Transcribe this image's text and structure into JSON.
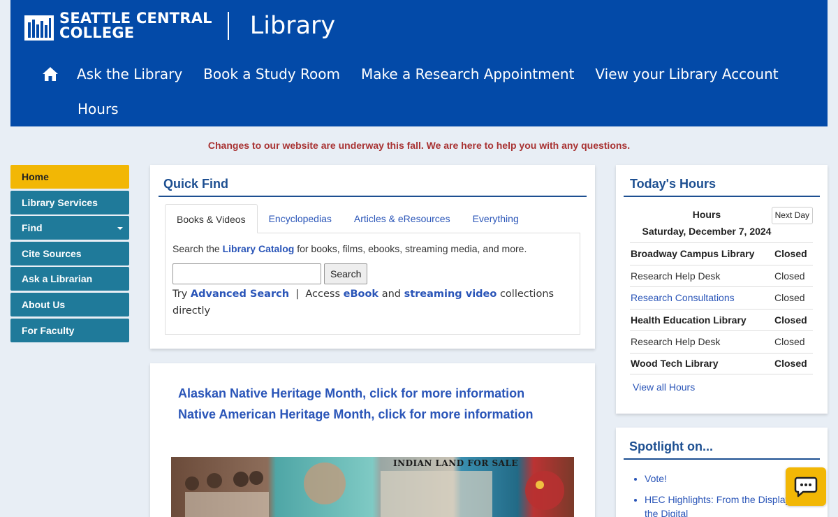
{
  "header": {
    "college_line1": "SEATTLE CENTRAL",
    "college_line2": "COLLEGE",
    "section": "Library",
    "nav": [
      "Ask the Library",
      "Book a Study Room",
      "Make a Research Appointment",
      "View your Library Account",
      "Hours"
    ]
  },
  "notice": "Changes to our website are underway this fall. We are here to help you with any questions.",
  "sidebar": {
    "items": [
      "Home",
      "Library Services",
      "Find",
      "Cite Sources",
      "Ask a Librarian",
      "About Us",
      "For Faculty"
    ],
    "active": "Home"
  },
  "quick_find": {
    "title": "Quick Find",
    "tabs": [
      "Books & Videos",
      "Encyclopedias",
      "Articles & eResources",
      "Everything"
    ],
    "desc_prefix": "Search the",
    "desc_link": "Library Catalog",
    "desc_suffix": "for books, films, ebooks, streaming media, and more.",
    "search_value": "",
    "search_button": "Search",
    "try": "Try",
    "advanced": "Advanced Search",
    "sep": "|",
    "access": "Access",
    "ebook": "eBook",
    "and": "and",
    "streaming": "streaming video",
    "tail": "collections directly"
  },
  "feature": {
    "links": [
      "Alaskan Native Heritage Month, click for more information",
      "Native American Heritage Month, click for more information"
    ],
    "image_caption": "INDIAN LAND FOR SALE"
  },
  "hours": {
    "title": "Today's Hours",
    "label": "Hours",
    "next_day": "Next Day",
    "date": "Saturday, December 7, 2024",
    "rows": [
      {
        "name": "Broadway Campus Library",
        "status": "Closed"
      },
      {
        "name": "Research Help Desk",
        "status": "Closed"
      },
      {
        "name": "Research Consultations",
        "status": "Closed"
      },
      {
        "name": "Health Education Library",
        "status": "Closed"
      },
      {
        "name": "Research Help Desk",
        "status": "Closed"
      },
      {
        "name": "Wood Tech Library",
        "status": "Closed"
      }
    ],
    "view_all": "View all Hours"
  },
  "spotlight": {
    "title": "Spotlight on...",
    "items": [
      "Vote!",
      "HEC Highlights: From the Display to the Digital"
    ]
  },
  "colors": {
    "header_blue": "#034aa8",
    "sidebar_teal": "#1f7a9a",
    "active_yellow": "#f2b705",
    "notice_red": "#a83232"
  }
}
